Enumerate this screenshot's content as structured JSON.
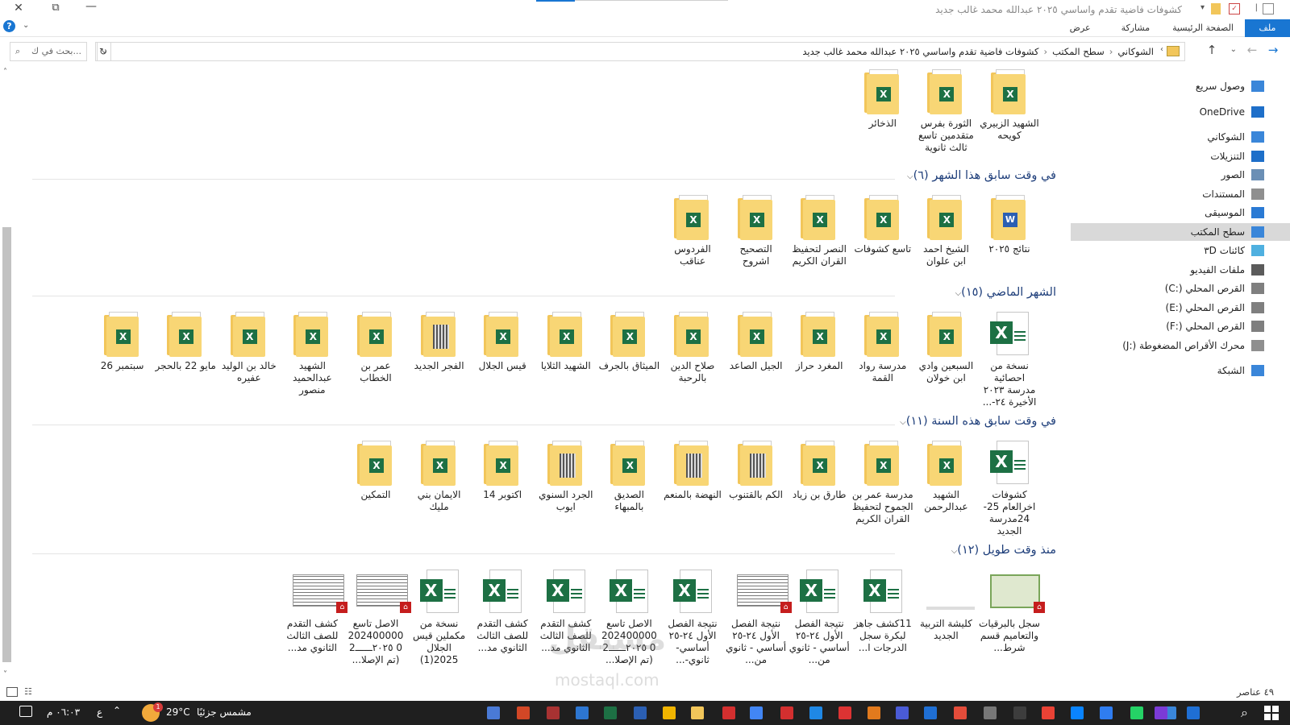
{
  "window": {
    "title": "كشوفات فاضية تقدم واساسي ٢٠٢٥ عبدالله محمد غالب جديد"
  },
  "ribbon": {
    "tabs": [
      {
        "label": "ملف",
        "active": true
      },
      {
        "label": "الصفحة الرئيسية"
      },
      {
        "label": "مشاركة"
      },
      {
        "label": "عرض"
      }
    ]
  },
  "address": {
    "breadcrumbs": [
      "الشوكاني",
      "سطح المكتب",
      "كشوفات فاضية تقدم واساسي ٢٠٢٥ عبدالله محمد غالب جديد"
    ],
    "search_placeholder": "بحث في ك..."
  },
  "sidebar": {
    "items": [
      {
        "label": "وصول سريع",
        "icon": "star-icon"
      },
      {
        "label": "OneDrive",
        "icon": "cloud-icon"
      },
      {
        "label": "الشوكاني",
        "icon": "pc-icon"
      },
      {
        "label": "التنزيلات",
        "icon": "download-icon"
      },
      {
        "label": "الصور",
        "icon": "pictures-icon"
      },
      {
        "label": "المستندات",
        "icon": "documents-icon"
      },
      {
        "label": "الموسيقى",
        "icon": "music-icon"
      },
      {
        "label": "سطح المكتب",
        "icon": "desktop-icon",
        "selected": true
      },
      {
        "label": "كائنات ٣D",
        "icon": "cube-icon"
      },
      {
        "label": "ملفات الفيديو",
        "icon": "video-icon"
      },
      {
        "label": "القرص المحلي (:C)",
        "icon": "drive-icon"
      },
      {
        "label": "القرص المحلي (:E)",
        "icon": "drive-icon"
      },
      {
        "label": "القرص المحلي (:F)",
        "icon": "drive-icon"
      },
      {
        "label": "محرك الأقراص المضغوطة (:J)",
        "icon": "cd-drive-icon"
      },
      {
        "label": "الشبكة",
        "icon": "network-icon"
      }
    ]
  },
  "groups": [
    {
      "header": "",
      "items": [
        {
          "label": "الشهيد الزبيري كويحه",
          "type": "folder-xl"
        },
        {
          "label": "الثورة بفرس متقدمين تاسع ثالث ثانوية",
          "type": "folder-xl"
        },
        {
          "label": "الذخائر",
          "type": "folder-xl"
        }
      ]
    },
    {
      "header": "في وقت سابق هذا الشهر (٦)",
      "items": [
        {
          "label": "نتائج ٢٠٢٥",
          "type": "folder-word"
        },
        {
          "label": "الشيخ احمد ابن علوان",
          "type": "folder-xl"
        },
        {
          "label": "تاسع كشوفات",
          "type": "folder-xl"
        },
        {
          "label": "النصر لتحفيظ القران الكريم",
          "type": "folder-xl"
        },
        {
          "label": "التصحيح اشروح",
          "type": "folder-xl"
        },
        {
          "label": "الفردوس عناقب",
          "type": "folder-xl"
        }
      ]
    },
    {
      "header": "الشهر الماضي (١٥)",
      "items": [
        {
          "label": "نسخة من احصائية مدرسة ٢٠٢٣ الأخيرة ٢٤-...",
          "type": "excel"
        },
        {
          "label": "السبعين وادي ابن خولان",
          "type": "folder-xl"
        },
        {
          "label": "مدرسة رواد القمة",
          "type": "folder-xl"
        },
        {
          "label": "المغرد حراز",
          "type": "folder-xl"
        },
        {
          "label": "الجيل الصاعد",
          "type": "folder-xl"
        },
        {
          "label": "صلاح الدين بالرحبة",
          "type": "folder-xl"
        },
        {
          "label": "الميثاق بالجرف",
          "type": "folder-xl"
        },
        {
          "label": "الشهيد الثلايا",
          "type": "folder-xl"
        },
        {
          "label": "قيس الجلال",
          "type": "folder-xl"
        },
        {
          "label": "الفجر الجديد",
          "type": "folder-doc"
        },
        {
          "label": "عمر بن الخطاب",
          "type": "folder-xl"
        },
        {
          "label": "الشهيد عبدالحميد منصور",
          "type": "folder-xl"
        },
        {
          "label": "خالد بن الوليد عفيره",
          "type": "folder-xl"
        },
        {
          "label": "مايو 22 بالحجر",
          "type": "folder-xl"
        },
        {
          "label": "سبتمبر 26",
          "type": "folder-xl"
        }
      ]
    },
    {
      "header": "في وقت سابق هذه السنة (١١)",
      "items": [
        {
          "label": "كشوفات اخرالعام 25-24مدرسة الجديد",
          "type": "excel"
        },
        {
          "label": "الشهيد عبدالرحمن",
          "type": "folder-xl"
        },
        {
          "label": "مدرسة عمر بن الجموح لتحفيظ القران الكريم",
          "type": "folder-xl"
        },
        {
          "label": "طارق بن زياد",
          "type": "folder-xl"
        },
        {
          "label": "الكم بالقتنوب",
          "type": "folder-doc"
        },
        {
          "label": "النهضة بالمنعم",
          "type": "folder-doc"
        },
        {
          "label": "الصديق بالمبهاء",
          "type": "folder-xl"
        },
        {
          "label": "الجرد السنوي ايوب",
          "type": "folder-doc"
        },
        {
          "label": "اكتوبر 14",
          "type": "folder-xl"
        },
        {
          "label": "الايمان بني مليك",
          "type": "folder-xl"
        },
        {
          "label": "التمكين",
          "type": "folder-xl"
        }
      ]
    },
    {
      "header": "منذ وقت طويل (١٢)",
      "items": [
        {
          "label": "سجل بالبرقيات والتعاميم قسم شرط...",
          "type": "pdf-cert"
        },
        {
          "label": "كليشة التربية الجديد",
          "type": "blank"
        },
        {
          "label": "11كشف جاهز لبكرة سجل الدرجات ا...",
          "type": "excel"
        },
        {
          "label": "نتيجة الفصل الأول ٢٤-٢٥ أساسي - ثانوي من...",
          "type": "excel"
        },
        {
          "label": "نتيجة الفصل الأول ٢٤-٢٥ أساسي - ثانوي من...",
          "type": "pdf"
        },
        {
          "label": "نتيجة الفصل الأول ٢٤-٢٥ أساسي- ثانوي-...",
          "type": "excel"
        },
        {
          "label": "الاصل تاسع 2024000000 ٢٠٢٥ــــــ2 (تم الإصلا...",
          "type": "excel"
        },
        {
          "label": "كشف التقدم للصف الثالث الثانوي مد...",
          "type": "excel"
        },
        {
          "label": "كشف التقدم للصف الثالث الثانوي مد...",
          "type": "excel"
        },
        {
          "label": "نسخة من مكملين قيس الجلال 2025(1)",
          "type": "excel"
        },
        {
          "label": "الاصل تاسع 2024000000 ٢٠٢٥ــــــ2 (تم الإصلا...",
          "type": "pdf"
        },
        {
          "label": "كشف التقدم للصف الثالث الثانوي مد...",
          "type": "pdf"
        }
      ]
    }
  ],
  "status": {
    "count": "٤٩ عناصر"
  },
  "taskbar": {
    "weather_text": "مشمس جزئيًا",
    "temperature": "29°C",
    "weather_badge": "1",
    "time": "٠٦:٠٣ م",
    "lang": "ع"
  },
  "watermark": {
    "text": "مستقل",
    "sub": "mostaql.com"
  },
  "colors": {
    "accent": "#1976d2",
    "header_text": "#1e3e7a",
    "excel_green": "#1d7044",
    "word_blue": "#2b5fb3",
    "pdf_red": "#c51d1d",
    "folder_yellow": "#f8d675",
    "taskbar_bg": "#1f1f1f"
  }
}
